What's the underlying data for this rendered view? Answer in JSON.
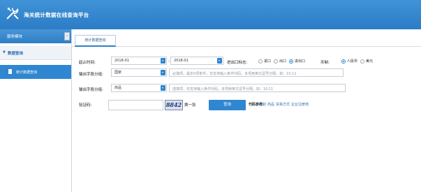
{
  "app": {
    "title": "海关统计数据在线查询平台"
  },
  "sidebar": {
    "module_header": "服务模块",
    "collapse_glyph": "‹",
    "section_label": "数据查询",
    "section_caret": "▼",
    "item_label": "统计数据查询"
  },
  "main": {
    "tab_label": "统计数据查询",
    "form": {
      "start_label": "起止时间:",
      "start_value": "2018-01",
      "dash": "-",
      "end_value": "2018-01",
      "direction_label": "进出口标志:",
      "direction_options": [
        "进口",
        "出口",
        "进出口"
      ],
      "direction_selected": "进出口",
      "currency_label": "币制:",
      "currency_options": [
        "人民币",
        "美元"
      ],
      "currency_selected": "人民币",
      "group1_label": "输出字段分组:",
      "group1_value": "国家",
      "group1_hint": "必填项，最多5项条件，仅支持输入条件代码，多项用英文逗号分隔，如：10,11",
      "group2_label": "输出字段分组:",
      "group2_value": "商品",
      "group2_hint": "选填项，仅支持输入条件代码，多项用英文逗号分隔，如：10,11",
      "captcha_label": "验证码:",
      "captcha_text": "8842",
      "refresh_label": "换一张",
      "query_button": "查询",
      "code_ref_label": "代码参考:",
      "code_links": [
        "国别",
        "商品",
        "贸易方式",
        "企业注册地"
      ]
    }
  }
}
